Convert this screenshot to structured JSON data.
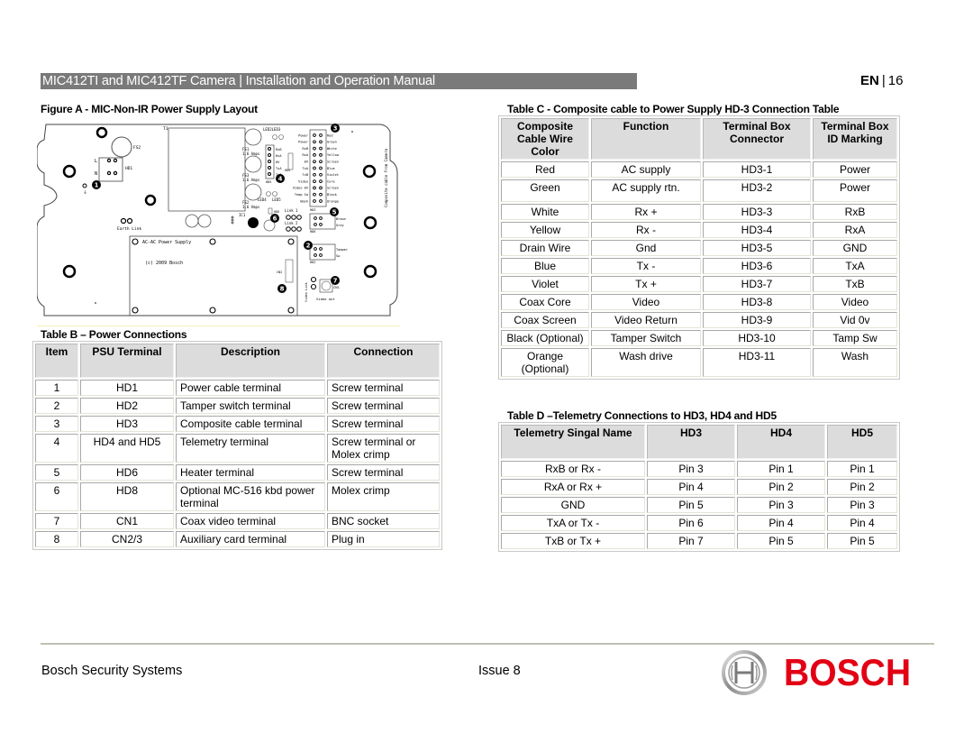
{
  "header": {
    "title": "MIC412TI and MIC412TF Camera | Installation and Operation Manual",
    "language": "EN",
    "separator": "|",
    "page_number": "16",
    "bar_color": "#7a7a7a"
  },
  "figure_a": {
    "caption": "Figure A - MIC-Non-IR Power Supply Layout",
    "labels": {
      "t1": "T1",
      "fs2_top": "FS2",
      "l": "L",
      "n": "N",
      "hd1": "HD1",
      "earth_link": "Earth Link",
      "fs1": "FS1",
      "fs1_rating": "1.6 Amps",
      "fs3": "FS3",
      "fs3_rating": "1.6 Amps",
      "fs2": "FS2",
      "fs2_rating": "1.6 Amps",
      "led2_led3": "LED2LED3",
      "led4": "LED4",
      "led5": "LED5",
      "ic1": "IC1",
      "hd5_pins": [
        "RxB",
        "RxA",
        "0V",
        "TxA",
        "TxB"
      ],
      "hd5": "HD5",
      "hd4": "HD4",
      "hd3_left": [
        "Power",
        "Power",
        "RxB",
        "RxA",
        "0V",
        "TxA",
        "TxB",
        "Video",
        "Video 0V",
        "Temp Sw",
        "Wash"
      ],
      "hd3_right": [
        "Red",
        "Green",
        "White",
        "Yellow",
        "Screen",
        "Blue",
        "Violet",
        "Core",
        "Screen",
        "Black",
        "Orange"
      ],
      "hd3": "HD3",
      "composite_cable": "Composite cable from Camera",
      "link1": "Link 1",
      "link2": "Link 2",
      "hd8": "HD8",
      "hd6_right": [
        "Brown",
        "Grey"
      ],
      "hd6": "HD6",
      "hd2_right": [
        "Tamper",
        "Sw"
      ],
      "hd2": "HD2",
      "ac_supply": "AC-AC Power Supply",
      "copyright": "(c) 2009 Bosch",
      "cn2": "CN2",
      "video_link": "Video Link",
      "cn1": "CN1",
      "video_out": "Video out"
    },
    "markers": [
      "1",
      "2",
      "3",
      "4",
      "5",
      "6",
      "7",
      "8"
    ]
  },
  "table_b": {
    "caption": "Table B – Power Connections",
    "headers": [
      "Item",
      "PSU Terminal",
      "Description",
      "Connection"
    ],
    "rows": [
      [
        "1",
        "HD1",
        "Power cable terminal",
        "Screw terminal"
      ],
      [
        "2",
        "HD2",
        "Tamper switch terminal",
        "Screw terminal"
      ],
      [
        "3",
        "HD3",
        "Composite cable terminal",
        "Screw terminal"
      ],
      [
        "4",
        "HD4 and HD5",
        "Telemetry terminal",
        "Screw terminal or Molex crimp"
      ],
      [
        "5",
        "HD6",
        "Heater terminal",
        "Screw terminal"
      ],
      [
        "6",
        "HD8",
        "Optional MC-516 kbd power terminal",
        "Molex crimp"
      ],
      [
        "7",
        "CN1",
        "Coax video terminal",
        "BNC socket"
      ],
      [
        "8",
        "CN2/3",
        "Auxiliary card terminal",
        "Plug in"
      ]
    ]
  },
  "table_c": {
    "caption": "Table C - Composite cable to Power Supply HD-3 Connection Table",
    "headers": [
      "Composite Cable Wire Color",
      "Function",
      "Terminal Box Connector",
      "Terminal Box ID Marking"
    ],
    "rows": [
      [
        "Red",
        "AC supply",
        "HD3-1",
        "Power"
      ],
      [
        "Green",
        "AC supply rtn.",
        "HD3-2",
        "Power"
      ],
      [
        "White",
        "Rx +",
        "HD3-3",
        "RxB"
      ],
      [
        "Yellow",
        "Rx -",
        "HD3-4",
        "RxA"
      ],
      [
        "Drain Wire",
        "Gnd",
        "HD3-5",
        "GND"
      ],
      [
        "Blue",
        "Tx -",
        "HD3-6",
        "TxA"
      ],
      [
        "Violet",
        "Tx +",
        "HD3-7",
        "TxB"
      ],
      [
        "Coax Core",
        "Video",
        "HD3-8",
        "Video"
      ],
      [
        "Coax Screen",
        "Video Return",
        "HD3-9",
        "Vid 0v"
      ],
      [
        "Black (Optional)",
        "Tamper Switch",
        "HD3-10",
        "Tamp Sw"
      ],
      [
        "Orange (Optional)",
        "Wash drive",
        "HD3-11",
        "Wash"
      ]
    ]
  },
  "table_d": {
    "caption": "Table D –Telemetry Connections to HD3, HD4 and HD5",
    "headers": [
      "Telemetry Singal Name",
      "HD3",
      "HD4",
      "HD5"
    ],
    "rows": [
      [
        "RxB or Rx -",
        "Pin 3",
        "Pin 1",
        "Pin 1"
      ],
      [
        "RxA or Rx +",
        "Pin 4",
        "Pin 2",
        "Pin 2"
      ],
      [
        "GND",
        "Pin 5",
        "Pin 3",
        "Pin 3"
      ],
      [
        "TxA or Tx -",
        "Pin 6",
        "Pin 4",
        "Pin 4"
      ],
      [
        "TxB or Tx +",
        "Pin 7",
        "Pin 5",
        "Pin 5"
      ]
    ]
  },
  "footer": {
    "company": "Bosch Security Systems",
    "issue": "Issue 8",
    "logo_text": "BOSCH",
    "logo_color": "#e20015"
  }
}
